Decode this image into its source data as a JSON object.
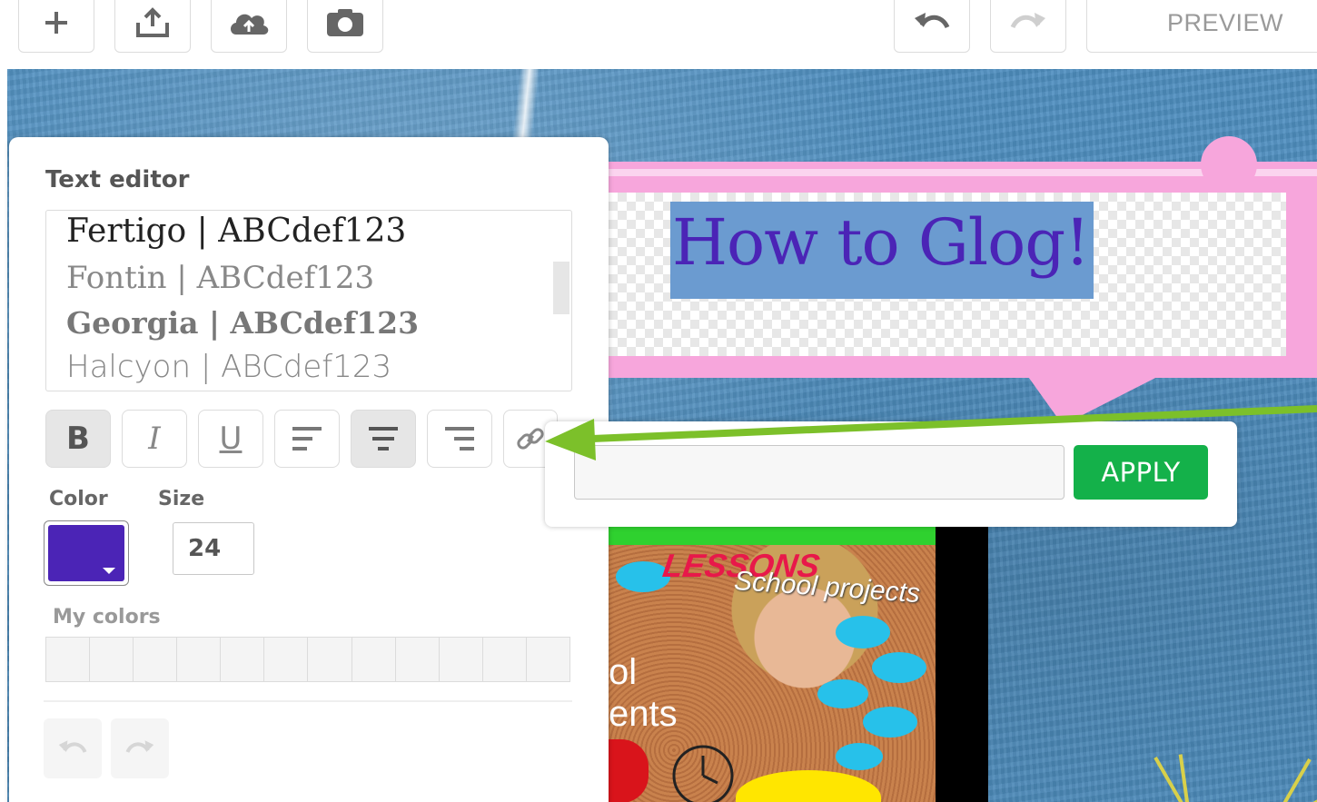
{
  "toolbar": {
    "add_icon": "plus-icon",
    "upload_icon": "upload-icon",
    "cloud_icon": "cloud-upload-icon",
    "camera_icon": "camera-icon",
    "undo_icon": "undo-icon",
    "redo_icon": "redo-icon",
    "preview_label": "PREVIEW"
  },
  "canvas": {
    "title_text": "How to Glog!",
    "title_color": "#4b24b6",
    "title_highlight_color": "#6b9bd0",
    "bubble_color": "#f7a6dc",
    "background_color": "#4f8fc0",
    "poster": {
      "banner_text": "LESSONS",
      "subtitle_text": "School projects",
      "partial_line_1": "ol",
      "partial_line_2": "ents"
    }
  },
  "text_editor": {
    "title": "Text editor",
    "fonts": [
      "Fertigo | ABCdef123",
      "Fontin | ABCdef123",
      "Georgia | ABCdef123",
      "Halcyon | ABCdef123"
    ],
    "format_buttons": {
      "bold": "B",
      "italic": "I",
      "underline": "U"
    },
    "color_label": "Color",
    "size_label": "Size",
    "selected_color": "#4b24b6",
    "size_value": "24",
    "my_colors_label": "My colors",
    "my_colors_count": 12
  },
  "link_popup": {
    "input_value": "",
    "apply_label": "APPLY",
    "apply_color": "#14b14a"
  },
  "annotation": {
    "arrow_color": "#7cc02a"
  }
}
